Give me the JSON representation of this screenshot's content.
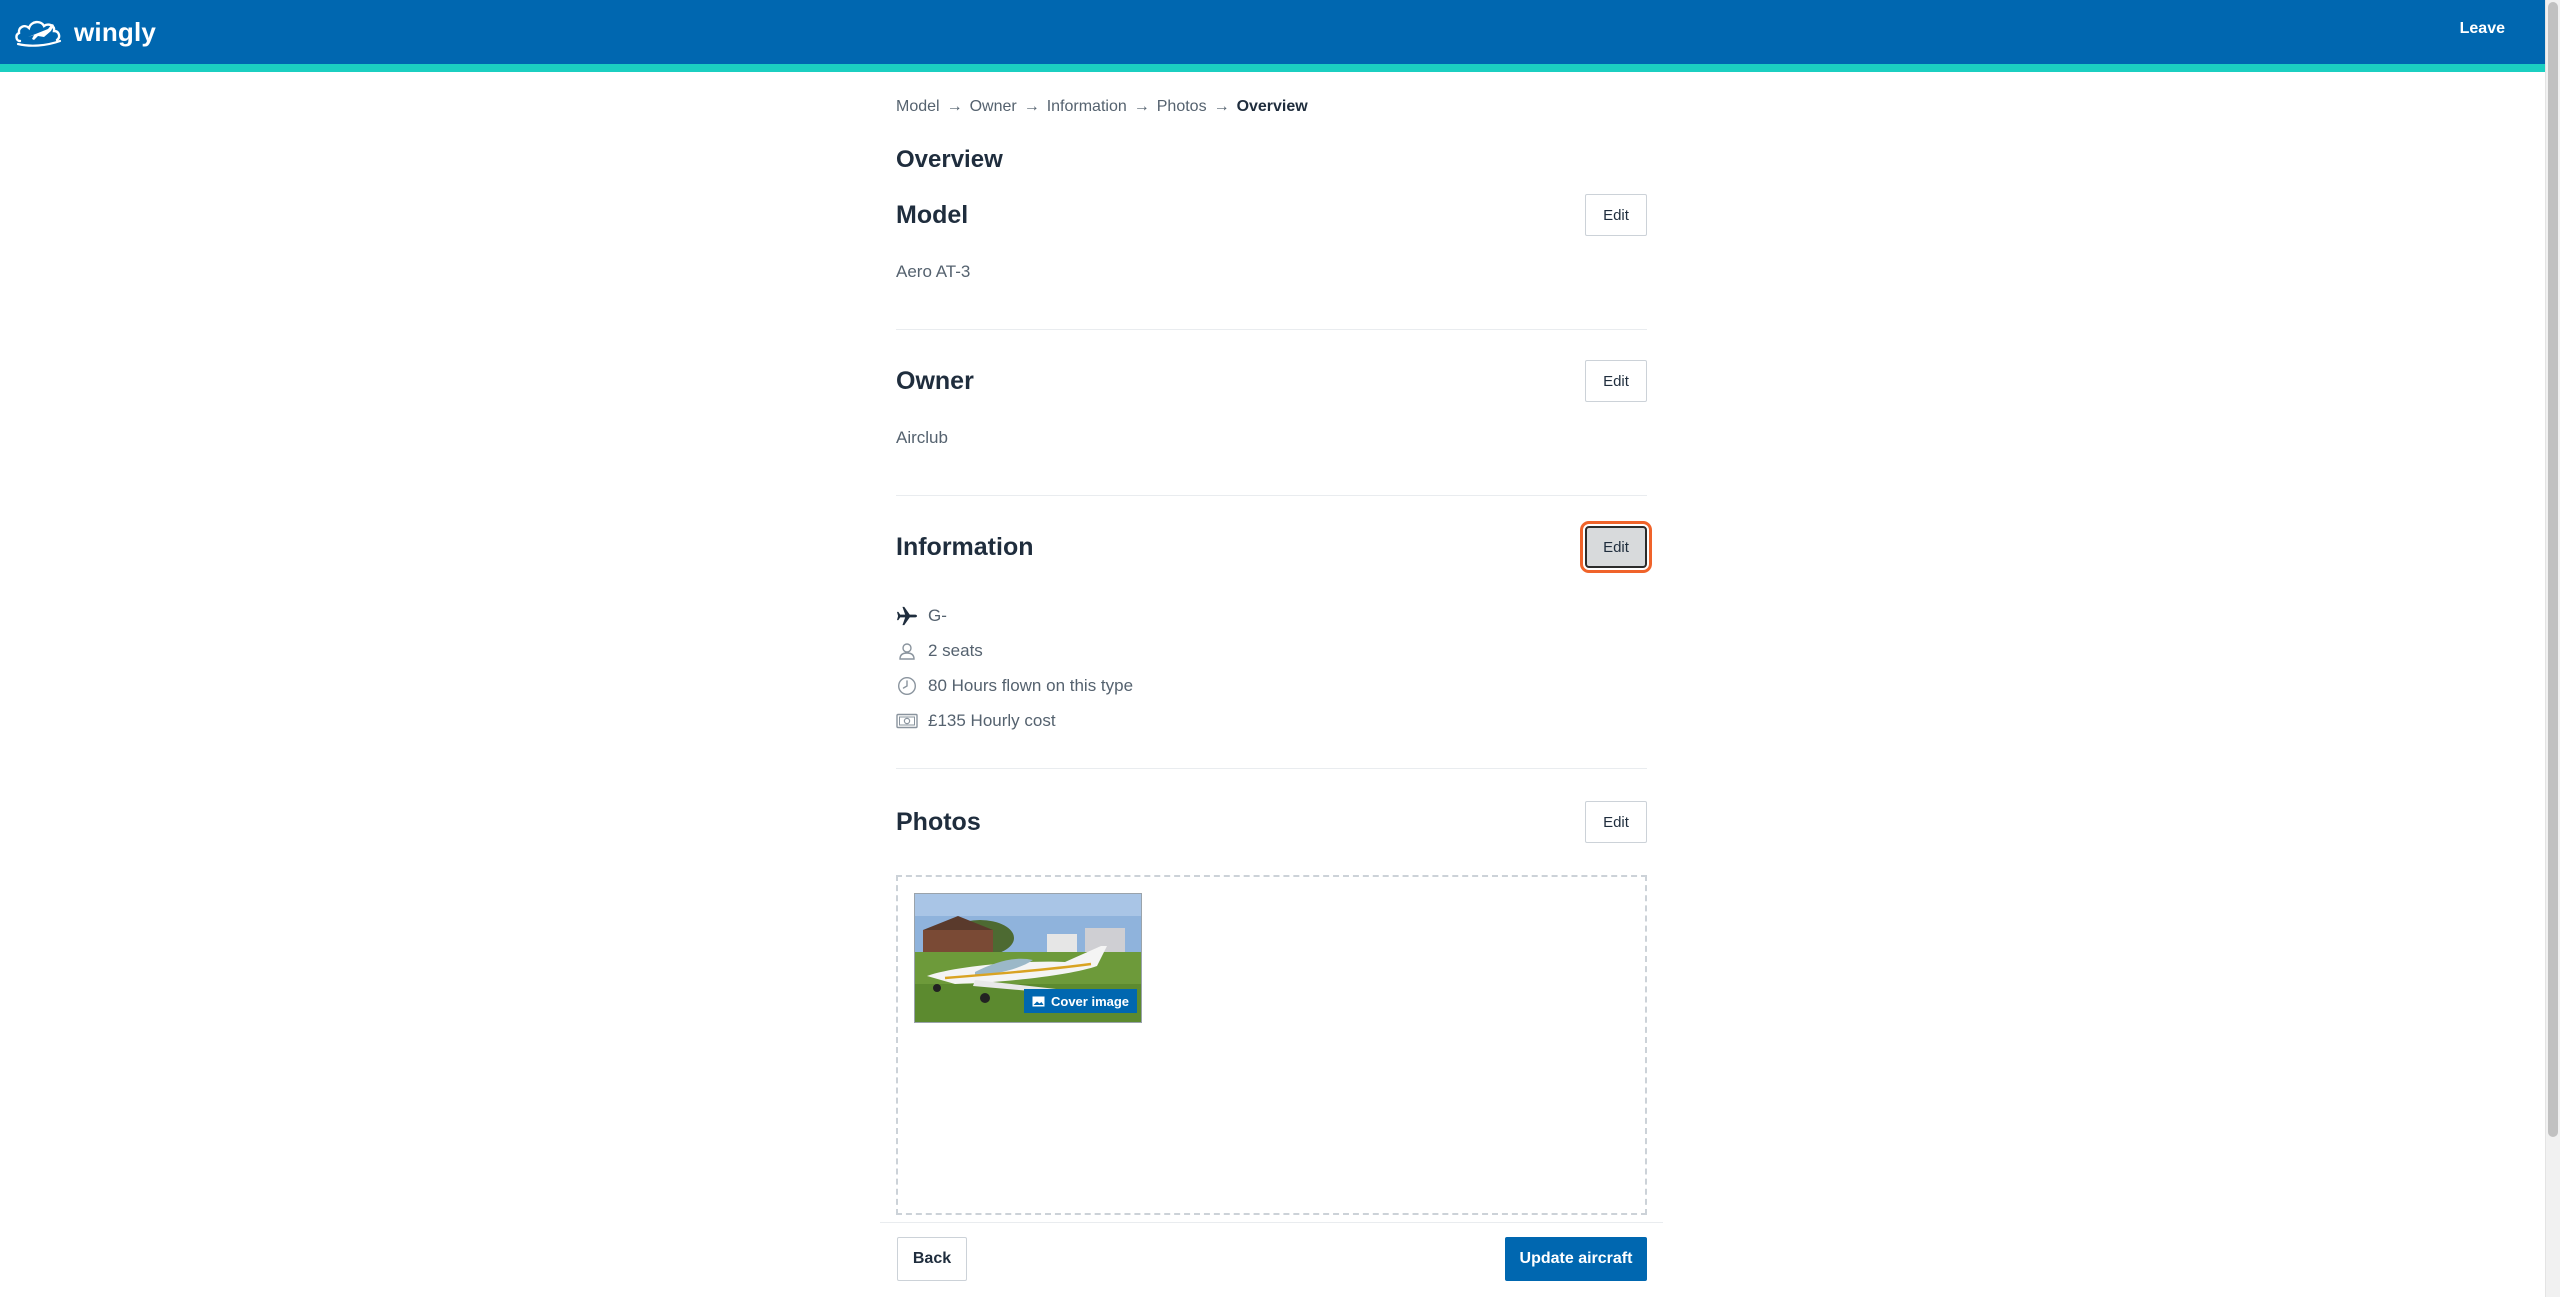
{
  "header": {
    "brand": "wingly",
    "leave_label": "Leave",
    "bar_color": "#0067b0",
    "accent_color": "#1bcfc1"
  },
  "breadcrumb": {
    "items": [
      "Model",
      "Owner",
      "Information",
      "Photos",
      "Overview"
    ],
    "separator": "→",
    "current_index": 4
  },
  "page_title": "Overview",
  "sections": {
    "model": {
      "title": "Model",
      "edit_label": "Edit",
      "value": "Aero AT-3"
    },
    "owner": {
      "title": "Owner",
      "edit_label": "Edit",
      "value": "Airclub"
    },
    "information": {
      "title": "Information",
      "edit_label": "Edit",
      "items": [
        {
          "icon": "airplane-icon",
          "text": "G-"
        },
        {
          "icon": "person-icon",
          "text": "2 seats"
        },
        {
          "icon": "clock-icon",
          "text": "80 Hours flown on this type"
        },
        {
          "icon": "banknote-icon",
          "text": "£135 Hourly cost"
        }
      ]
    },
    "photos": {
      "title": "Photos",
      "edit_label": "Edit",
      "cover_label": "Cover image"
    }
  },
  "footer": {
    "back_label": "Back",
    "update_label": "Update aircraft"
  }
}
